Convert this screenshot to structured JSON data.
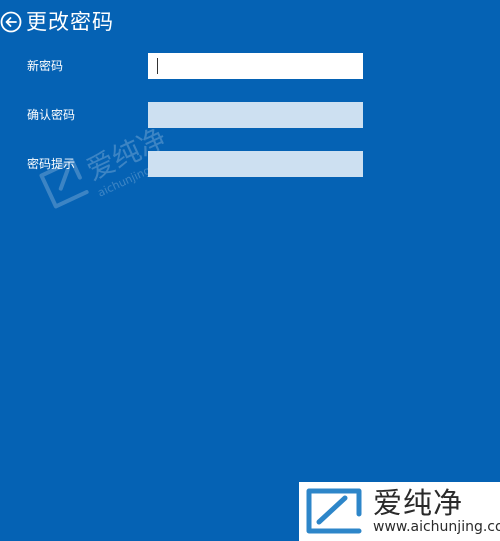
{
  "header": {
    "title": "更改密码",
    "back_icon": "back-arrow-circle-icon"
  },
  "form": {
    "fields": [
      {
        "label": "新密码",
        "value": "",
        "placeholder": "",
        "state": "focused"
      },
      {
        "label": "确认密码",
        "value": "",
        "placeholder": "",
        "state": "default"
      },
      {
        "label": "密码提示",
        "value": "",
        "placeholder": "",
        "state": "default"
      }
    ]
  },
  "watermark": {
    "name": "爱纯净",
    "domain": "aichunjing.com"
  },
  "logo": {
    "name": "爱纯净",
    "domain": "www.aichunjing.com"
  },
  "colors": {
    "background": "#0562b4",
    "input_active": "#ffffff",
    "input_inactive": "#cde0f1",
    "text": "#ffffff"
  }
}
